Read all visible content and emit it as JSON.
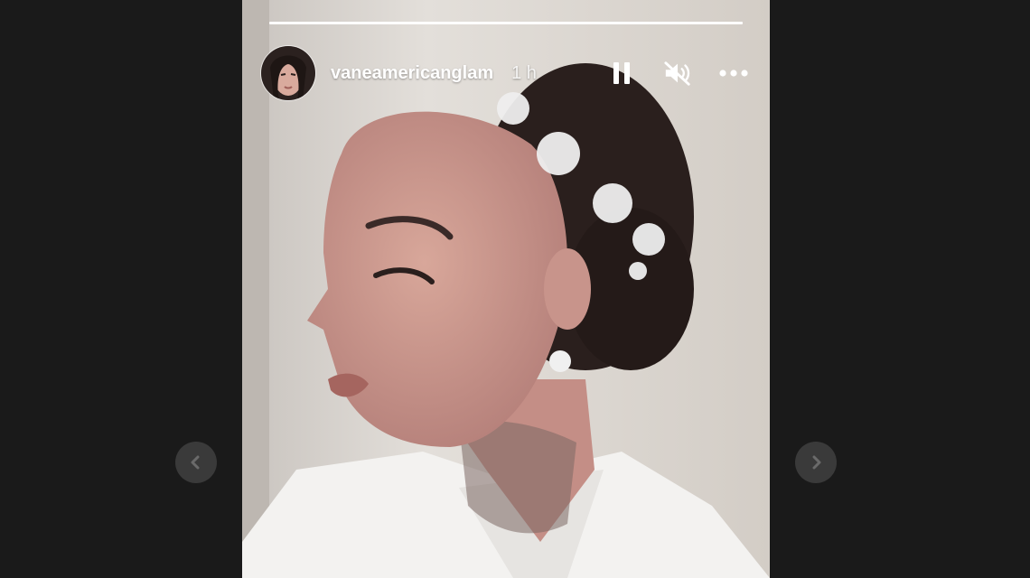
{
  "story": {
    "username": "vaneamericanglam",
    "time_ago": "1 h",
    "segments": 1
  },
  "controls": {
    "pause_icon": "pause-icon",
    "mute_icon": "speaker-muted-icon",
    "more_icon": "more-horizontal-icon"
  },
  "navigation": {
    "prev_icon": "chevron-left-icon",
    "next_icon": "chevron-right-icon"
  },
  "colors": {
    "backdrop": "#1a1a1a",
    "nav_button": "#3a3a3a",
    "text": "#ffffff"
  }
}
